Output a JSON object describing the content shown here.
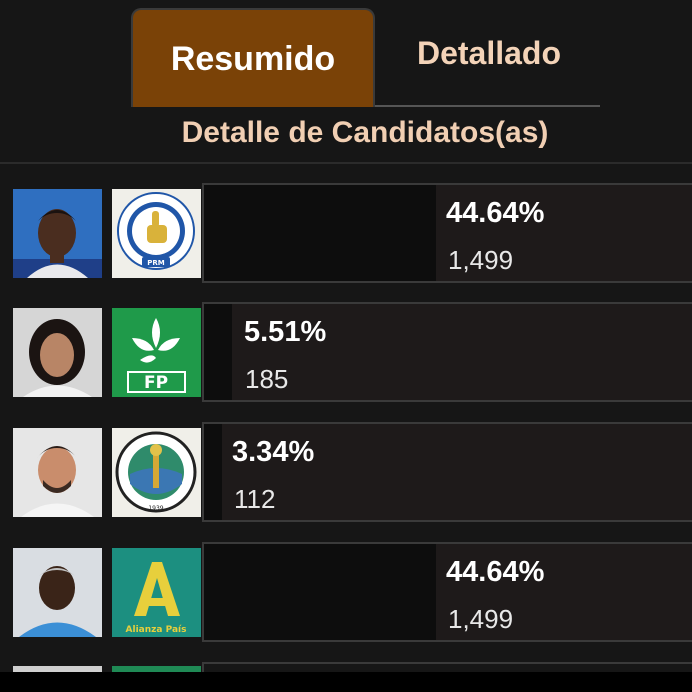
{
  "tabs": {
    "active": "Resumido",
    "inactive": "Detallado"
  },
  "section_title": "Detalle de Candidatos(as)",
  "candidates": [
    {
      "percent": "44.64%",
      "votes": "1,499",
      "share": 0.4464,
      "party_logo": "PRM",
      "party_logo_text": "PARTIDO REVOLUCIONARIO MODERNO"
    },
    {
      "percent": "5.51%",
      "votes": "185",
      "share": 0.0551,
      "party_logo": "FP"
    },
    {
      "percent": "3.34%",
      "votes": "112",
      "share": 0.0334,
      "party_logo": "PRD",
      "party_logo_text": "PARTIDO REVOLUCIONARIO DOMINICANO 1939"
    },
    {
      "percent": "44.64%",
      "votes": "1,499",
      "share": 0.4464,
      "party_logo": "Alianza País"
    }
  ],
  "colors": {
    "active_tab": "#7a4207",
    "title_text": "#f1cfb3",
    "fp_green": "#1f9a4a",
    "alianza_teal": "#1c8f80",
    "alianza_yellow": "#e7cf3c"
  }
}
